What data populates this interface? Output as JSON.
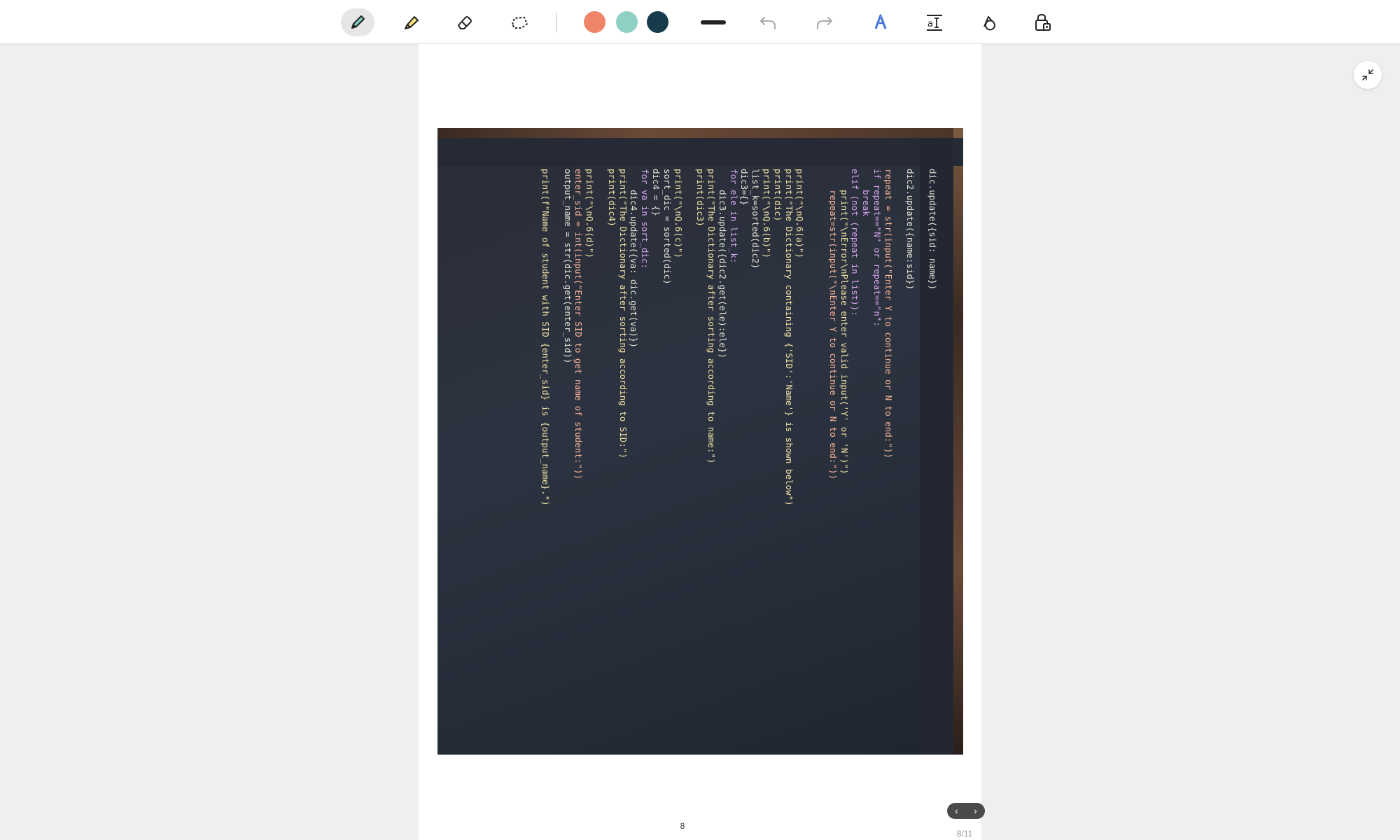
{
  "toolbar": {
    "tools": [
      {
        "name": "pen-tool",
        "icon": "pen-icon",
        "active": true
      },
      {
        "name": "highlighter-tool",
        "icon": "highlighter-icon",
        "active": false
      },
      {
        "name": "eraser-tool",
        "icon": "eraser-icon",
        "active": false
      },
      {
        "name": "lasso-tool",
        "icon": "lasso-icon",
        "active": false
      }
    ],
    "colors": [
      "#ef8468",
      "#8fd0c4",
      "#173b4b"
    ],
    "actions": [
      "stroke-width",
      "undo",
      "redo",
      "text-recognition",
      "text-formatting",
      "shapes",
      "lock"
    ]
  },
  "document": {
    "page_number": "8",
    "page_count": "8/11",
    "photo_code_lines": [
      "dic.update({sid: name})",
      "",
      "dic2.update({name:sid})",
      "",
      "repeat = str(input(\"Enter Y to continue or N to end:\"))",
      "if repeat==\"N\" or repeat==\"n\":",
      "    break",
      "elif (not (repeat in list)):",
      "    print(\"\\nError\\nPlease enter valid input('Y' or 'N')\")",
      "    repeat=str(input(\"\\nEnter Y to continue or N to end:\"))",
      "",
      "",
      "print(\"\\nQ.6(a)\")",
      "print(\"The Dictionary containing {'SID':'Name'} is shown below\")",
      "print(dic)",
      "print(\"\\nQ.6(b)\")",
      "list_k=sorted(dic2)",
      "dic3={}",
      "for ele in list_k:",
      "    dic3.update({dic2.get(ele):ele})",
      "print(\"The Dictionary after sorting according to name:\")",
      "print(dic3)",
      "",
      "print(\"\\nQ.6(c)\")",
      "sort_dic = sorted(dic)",
      "dic4 = {}",
      "for va in sort_dic:",
      "    dic4.update({va: dic.get(va)})",
      "print(\"The Dictionary after sorting according to SID:\")",
      "print(dic4)",
      "",
      "print(\"\\nQ.6(d)\")",
      "enter_sid = int(input(\"Enter SID to get name of student:\"))",
      "output_name = str(dic.get(enter_sid))",
      "",
      "print(f\"Name of student with SID {enter_sid} is {output_name}.\")"
    ]
  },
  "navigation": {
    "prev_label": "‹",
    "next_label": "›"
  }
}
